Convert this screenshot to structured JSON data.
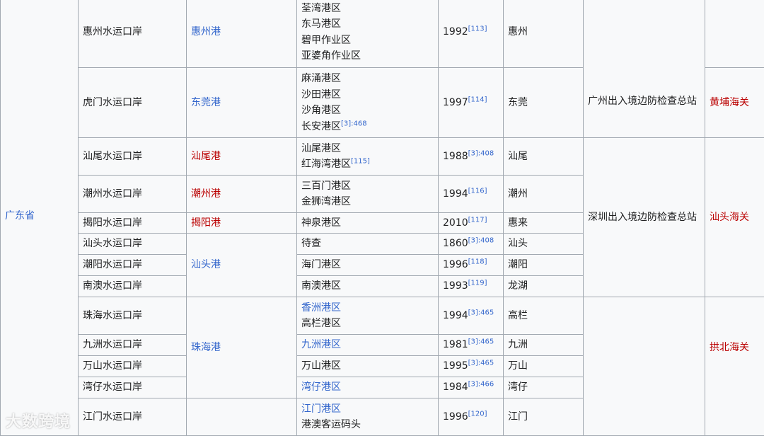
{
  "province": "广东省",
  "rows": [
    {
      "id": "r1",
      "port": "惠州水运口岸",
      "harbor": "惠州港",
      "areas": [
        "荃湾港区",
        "东马港区",
        "碧甲作业区",
        "亚婆角作业区"
      ],
      "year": "1992",
      "ref": "[113]",
      "city": "惠州"
    },
    {
      "id": "r2",
      "port": "虎门水运口岸",
      "harbor": "东莞港",
      "areas": [
        "麻涌港区",
        "沙田港区",
        "沙角港区",
        "长安港区"
      ],
      "area_last_ref": "[3]:468",
      "year": "1997",
      "ref": "[114]",
      "city": "东莞"
    },
    {
      "id": "r3",
      "port": "汕尾水运口岸",
      "harbor": "汕尾港",
      "areas": [
        "汕尾港区",
        "红海湾港区"
      ],
      "area_last_ref": "[115]",
      "year": "1988",
      "ref": "[3]:408",
      "city": "汕尾"
    },
    {
      "id": "r4",
      "port": "潮州水运口岸",
      "harbor": "潮州港",
      "areas": [
        "三百门港区",
        "金狮湾港区"
      ],
      "year": "1994",
      "ref": "[116]",
      "city": "潮州"
    },
    {
      "id": "r5",
      "port": "揭阳水运口岸",
      "harbor": "揭阳港",
      "areas": [
        "神泉港区"
      ],
      "year": "2010",
      "ref": "[117]",
      "city": "惠来"
    },
    {
      "id": "r6",
      "port": "汕头水运口岸",
      "harbor": "汕头港",
      "areas": [
        "待查"
      ],
      "year": "1860",
      "ref": "[3]:408",
      "city": "汕头"
    },
    {
      "id": "r7",
      "port": "潮阳水运口岸",
      "areas": [
        "海门港区"
      ],
      "year": "1996",
      "ref": "[118]",
      "city": "潮阳"
    },
    {
      "id": "r8",
      "port": "南澳水运口岸",
      "areas": [
        "南澳港区"
      ],
      "year": "1993",
      "ref": "[119]",
      "city": "龙湖"
    },
    {
      "id": "r9",
      "port": "珠海水运口岸",
      "harbor": "珠海港",
      "areas": [
        "香洲港区",
        "高栏港区"
      ],
      "year": "1994",
      "ref": "[3]:465",
      "city": "高栏"
    },
    {
      "id": "r10",
      "port": "九洲水运口岸",
      "areas": [
        "九洲港区"
      ],
      "year": "1981",
      "ref": "[3]:465",
      "city": "九洲"
    },
    {
      "id": "r11",
      "port": "万山水运口岸",
      "areas": [
        "万山港区"
      ],
      "year": "1995",
      "ref": "[3]:465",
      "city": "万山"
    },
    {
      "id": "r12",
      "port": "湾仔水运口岸",
      "areas": [
        "湾仔港区"
      ],
      "year": "1984",
      "ref": "[3]:466",
      "city": "湾仔"
    },
    {
      "id": "r13",
      "port": "江门水运口岸",
      "areas": [
        "江门港区",
        "港澳客运码头"
      ],
      "year": "1996",
      "ref": "[120]",
      "city": "江门"
    }
  ],
  "border_stations": {
    "guangzhou": "广州出入境边防检查总站",
    "shenzhen": "深圳出入境边防检查总站"
  },
  "customs": {
    "huangpu": "黄埔海关",
    "shantou": "汕头海关",
    "gongbei": "拱北海关"
  },
  "watermark": "大数跨境"
}
